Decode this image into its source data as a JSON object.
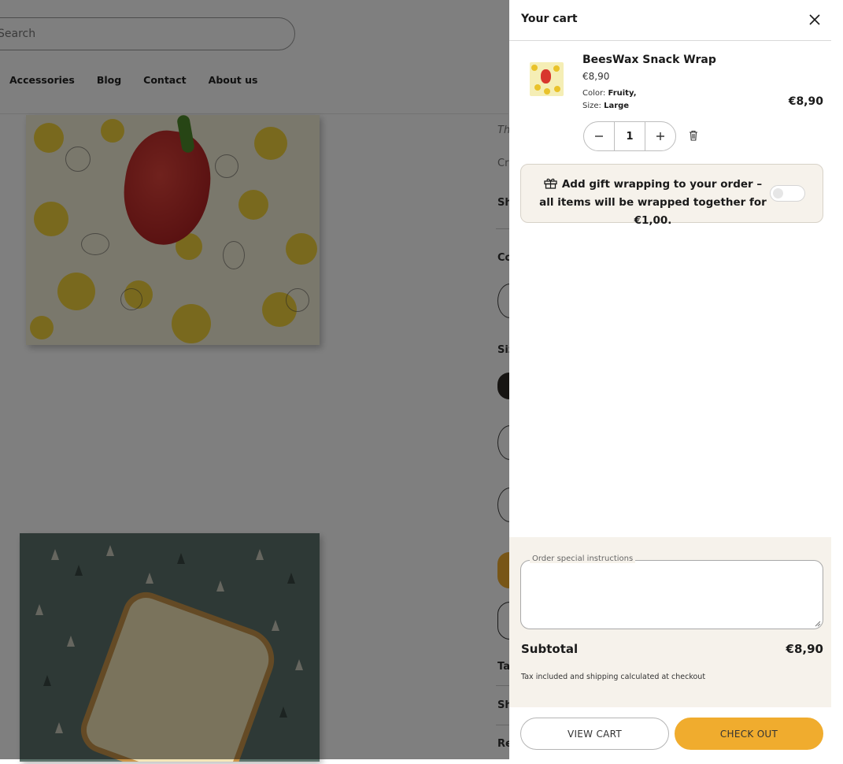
{
  "header": {
    "search_placeholder": "Search",
    "nav": [
      "Accessories",
      "Blog",
      "Contact",
      "About us"
    ]
  },
  "product_info_fragments": [
    "Th",
    "Cr",
    "Sh",
    "Co",
    "Siz",
    "Ta",
    "Sh",
    "Re"
  ],
  "cart": {
    "title": "Your cart",
    "item": {
      "name": "BeesWax Snack Wrap",
      "price": "€8,90",
      "color_label": "Color:",
      "color_value": "Fruity,",
      "size_label": "Size:",
      "size_value": "Large",
      "quantity": "1",
      "line_total": "€8,90"
    },
    "gift": {
      "text": "Add gift wrapping to your order – all items will be wrapped together for €1,00.",
      "enabled": false
    },
    "instructions_label": "Order special instructions",
    "instructions_value": "",
    "subtotal_label": "Subtotal",
    "subtotal_value": "€8,90",
    "tax_note": "Tax included and shipping calculated at checkout",
    "view_cart_label": "VIEW CART",
    "checkout_label": "CHECK OUT"
  },
  "colors": {
    "accent": "#f0ac2e",
    "footer_bg": "#f6f2eb",
    "overlay": "rgba(0,0,0,0.5)"
  }
}
